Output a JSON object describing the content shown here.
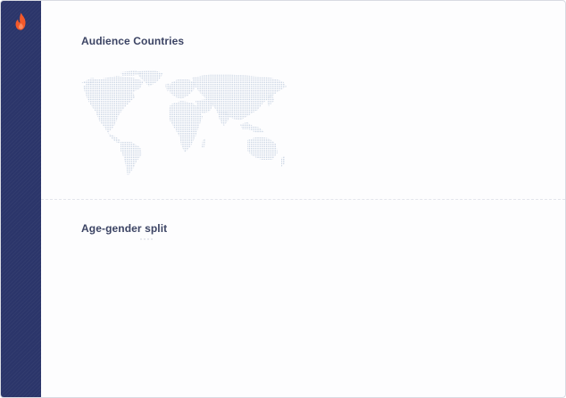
{
  "sidebar": {
    "logo_icon": "flame-icon",
    "logo_color": "#f4592a",
    "background": "#2b356a"
  },
  "sections": {
    "audience_countries": {
      "title": "Audience Countries",
      "map_icon": "world-map-dotted",
      "map_color": "#c9d4e3"
    },
    "age_gender": {
      "title": "Age-gender split"
    }
  }
}
